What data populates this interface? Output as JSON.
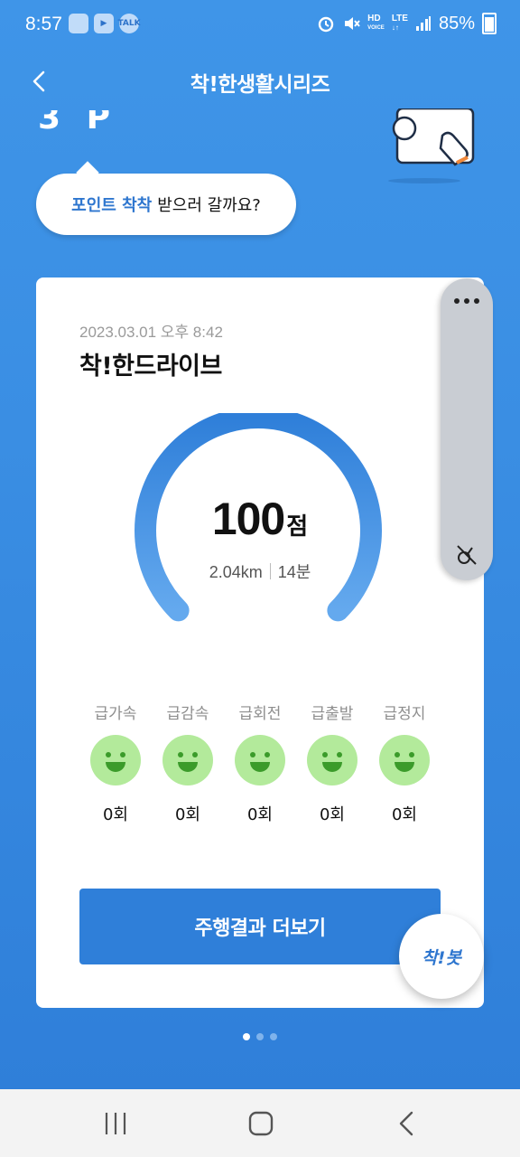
{
  "status_bar": {
    "time": "8:57",
    "left_icons": [
      "message-app-icon",
      "media-app-icon",
      "kakaotalk-icon"
    ],
    "kakaotalk_label": "TALK",
    "right_icons": [
      "alarm-icon",
      "mute-icon",
      "volte-icon",
      "lte-icon",
      "signal-icon",
      "battery-icon"
    ],
    "hd_label": "HD",
    "lte_label": "LTE",
    "battery": "85%"
  },
  "header": {
    "title": "착!한생활시리즈",
    "back_icon": "chevron-left-icon"
  },
  "points_partial": "3 P",
  "bubble": {
    "highlight": "포인트 착착",
    "text": "받으러 갈까요?"
  },
  "card": {
    "date": "2023.03.01 오후 8:42",
    "title": "착!한드라이브",
    "score": "100",
    "score_unit": "점",
    "score_fraction": 1.0,
    "distance": "2.04km",
    "duration": "14분",
    "events": [
      {
        "label": "급가속",
        "count": "0회",
        "icon": "smile-face-icon"
      },
      {
        "label": "급감속",
        "count": "0회",
        "icon": "smile-face-icon"
      },
      {
        "label": "급회전",
        "count": "0회",
        "icon": "smile-face-icon"
      },
      {
        "label": "급출발",
        "count": "0회",
        "icon": "smile-face-icon"
      },
      {
        "label": "급정지",
        "count": "0회",
        "icon": "smile-face-icon"
      }
    ],
    "more_button": "주행결과 더보기",
    "chatbot_label": "착!봇"
  },
  "side_panel": {
    "icons": [
      "more-dots-icon",
      "driving-off-icon"
    ]
  },
  "pager": {
    "count": 3,
    "active": 1
  },
  "colors": {
    "background": "#3b8fe3",
    "accent": "#2f7fd9",
    "face": "#b3ea9b"
  }
}
